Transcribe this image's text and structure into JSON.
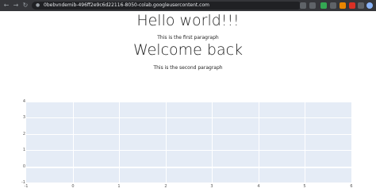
{
  "browser": {
    "url": "0bebvndemib-496ff2e9c6d22116-8050-colab.googleusercontent.com",
    "icons": [
      "back-icon",
      "forward-icon",
      "reload-icon",
      "share-icon",
      "star-icon",
      "extension-icon",
      "extension-icon",
      "extension-icon",
      "extension-icon",
      "puzzle-icon",
      "profile-icon",
      "menu-icon"
    ]
  },
  "page": {
    "heading1": "Hello world!!!",
    "paragraph1": "This is the first paragraph",
    "heading2": "Welcome back",
    "paragraph2": "This is the second paragraph"
  },
  "chart_data": {
    "type": "line",
    "series": [],
    "xlim": [
      -1,
      6
    ],
    "ylim": [
      -1,
      4
    ],
    "x_ticks": [
      "-1",
      "0",
      "1",
      "2",
      "3",
      "4",
      "5",
      "6"
    ],
    "y_ticks": [
      "4",
      "3",
      "2",
      "1",
      "0",
      "-1"
    ],
    "grid": true,
    "background": "#e5ecf6"
  }
}
